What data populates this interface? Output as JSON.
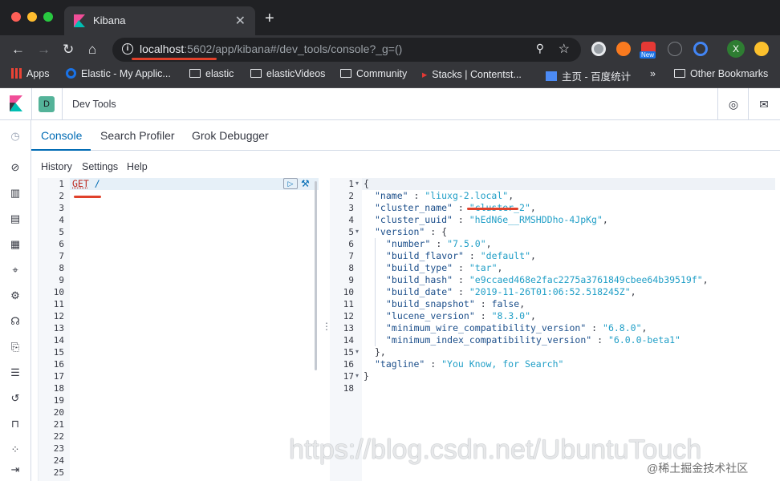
{
  "browser": {
    "tab_title": "Kibana",
    "tab_close": "✕",
    "new_tab": "+",
    "url_host": "localhost",
    "url_rest": ":5602/app/kibana#/dev_tools/console?_g=()",
    "ext_new_badge": "New",
    "profile_initial": "X"
  },
  "bookmarks": [
    {
      "label": "Apps"
    },
    {
      "label": "Elastic - My Applic..."
    },
    {
      "label": "elastic"
    },
    {
      "label": "elasticVideos"
    },
    {
      "label": "Community"
    },
    {
      "label": "Stacks | Contentst..."
    },
    {
      "label": "主页 - 百度统计"
    },
    {
      "label": "»"
    },
    {
      "label": "Other Bookmarks"
    }
  ],
  "app": {
    "space_initial": "D",
    "breadcrumb": "Dev Tools",
    "tabs": [
      {
        "label": "Console"
      },
      {
        "label": "Search Profiler"
      },
      {
        "label": "Grok Debugger"
      }
    ],
    "menu": [
      {
        "label": "History"
      },
      {
        "label": "Settings"
      },
      {
        "label": "Help"
      }
    ]
  },
  "request_editor": {
    "line_numbers": [
      "1",
      "2",
      "3",
      "4",
      "5",
      "6",
      "7",
      "8",
      "9",
      "10",
      "11",
      "12",
      "13",
      "14",
      "15",
      "16",
      "17",
      "18",
      "19",
      "20",
      "21",
      "22",
      "23",
      "24",
      "25"
    ],
    "method": "GET",
    "path": " /"
  },
  "response_editor": {
    "line_numbers": [
      "1",
      "2",
      "3",
      "4",
      "5",
      "6",
      "7",
      "8",
      "9",
      "10",
      "11",
      "12",
      "13",
      "14",
      "15",
      "16",
      "17",
      "18"
    ],
    "fold_markers": {
      "1": "▾",
      "5": "▾",
      "15": "▾",
      "17": "▾"
    },
    "lines": [
      {
        "key": "{",
        "val": ""
      },
      {
        "key": "\"name\"",
        "val": "\"liuxg-2.local\""
      },
      {
        "key": "\"cluster_name\"",
        "val": "\"cluster_2\""
      },
      {
        "key": "\"cluster_uuid\"",
        "val": "\"hEdN6e__RMSHDDho-4JpKg\""
      },
      {
        "key": "\"version\"",
        "val": "{"
      },
      {
        "key": "\"number\"",
        "val": "\"7.5.0\""
      },
      {
        "key": "\"build_flavor\"",
        "val": "\"default\""
      },
      {
        "key": "\"build_type\"",
        "val": "\"tar\""
      },
      {
        "key": "\"build_hash\"",
        "val": "\"e9ccaed468e2fac2275a3761849cbee64b39519f\""
      },
      {
        "key": "\"build_date\"",
        "val": "\"2019-11-26T01:06:52.518245Z\""
      },
      {
        "key": "\"build_snapshot\"",
        "val": "false"
      },
      {
        "key": "\"lucene_version\"",
        "val": "\"8.3.0\""
      },
      {
        "key": "\"minimum_wire_compatibility_version\"",
        "val": "\"6.8.0\""
      },
      {
        "key": "\"minimum_index_compatibility_version\"",
        "val": "\"6.0.0-beta1\""
      },
      {
        "key": "},",
        "val": ""
      },
      {
        "key": "\"tagline\"",
        "val": "\"You Know, for Search\""
      },
      {
        "key": "}",
        "val": ""
      },
      {
        "key": "",
        "val": ""
      }
    ]
  },
  "watermark": {
    "url": "https://blog.csdn.net/UbuntuTouch",
    "credit": "@稀土掘金技术社区"
  },
  "colors": {
    "accent": "#006bb4",
    "space_badge": "#54b399",
    "annotation": "#e0412b"
  }
}
